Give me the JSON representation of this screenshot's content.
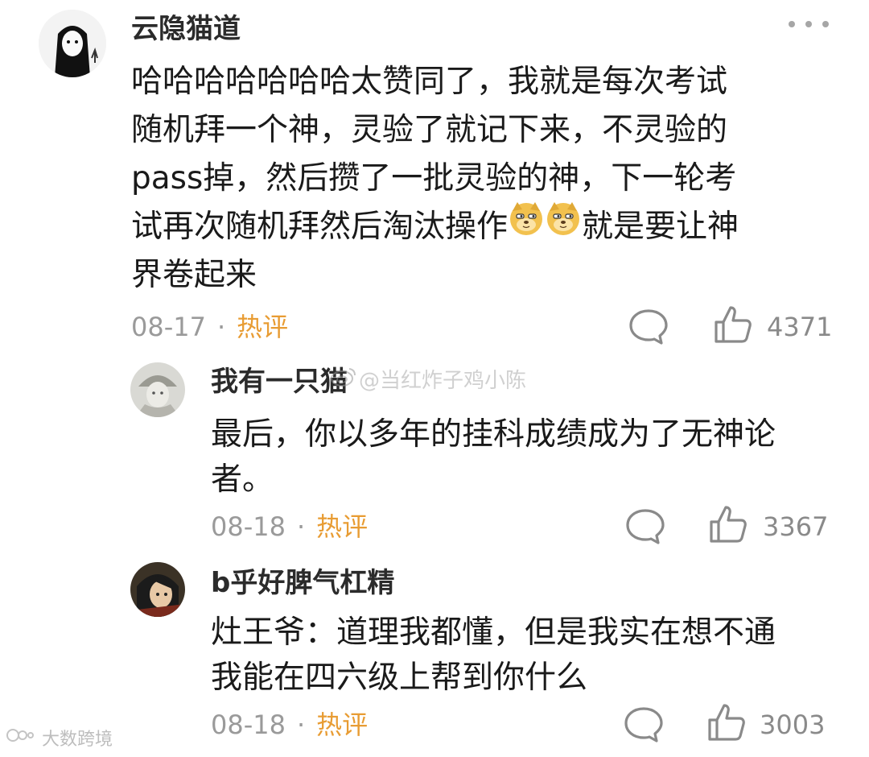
{
  "comments": [
    {
      "user": "云隐猫道",
      "lines": [
        "哈哈哈哈哈哈哈太赞同了，我就是每次考试",
        "随机拜一个神，灵验了就记下来，不灵验的",
        "pass掉，然后攒了一批灵验的神，下一轮考",
        "试再次随机拜然后淘汰操作",
        "界卷起来"
      ],
      "line4_after": "就是要让神",
      "date": "08-17",
      "dot": "·",
      "tag": "热评",
      "likes": "4371"
    },
    {
      "user": "我有一只猫",
      "lines": [
        "最后，你以多年的挂科成绩成为了无神论",
        "者。"
      ],
      "date": "08-18",
      "dot": "·",
      "tag": "热评",
      "likes": "3367"
    },
    {
      "user": "b乎好脾气杠精",
      "lines": [
        "灶王爷：道理我都懂，但是我实在想不通",
        "我能在四六级上帮到你什么"
      ],
      "date": "08-18",
      "dot": "·",
      "tag": "热评",
      "likes": "3003"
    }
  ],
  "watermark": "@当红炸子鸡小陈",
  "brand": "大数跨境",
  "colors": {
    "hot_tag": "#e89c33",
    "meta": "#9a9a9a",
    "icon": "#8a8a8a"
  },
  "icons": [
    "more-icon",
    "comment-icon",
    "like-icon",
    "doge-emoji",
    "weibo-icon"
  ]
}
